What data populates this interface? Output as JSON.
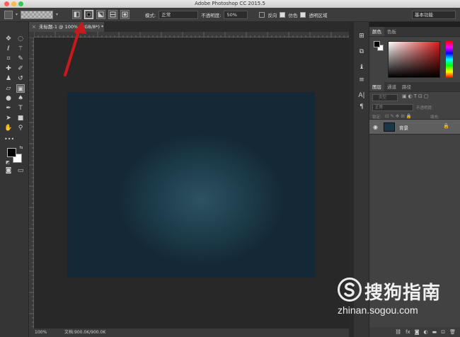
{
  "window": {
    "title": "Adobe Photoshop CC 2015.5"
  },
  "options_bar": {
    "mode_label": "模式:",
    "mode_value": "正常",
    "opacity_label": "不透明度:",
    "opacity_value": "50%",
    "reverse_label": "反向",
    "dither_label": "仿色",
    "transparency_label": "透明区域",
    "workspace": "基本功能",
    "gradient_styles": [
      "linear",
      "radial",
      "angle",
      "reflected",
      "diamond"
    ],
    "active_style": "radial",
    "reverse_checked": false,
    "dither_checked": true,
    "transparency_checked": true
  },
  "document": {
    "tab_label": "未标题-1 @ 100% (RGB/8*) *",
    "close_glyph": "×",
    "canvas_color": "#1d3c4b"
  },
  "status": {
    "zoom": "100%",
    "doc_info": "文档:900.0K/900.0K"
  },
  "panels": {
    "color_tabs": [
      "颜色",
      "色板"
    ],
    "layers_tabs": [
      "图层",
      "通道",
      "路径"
    ],
    "layer_kind_label": "类型",
    "blend_mode": "正常",
    "opacity_label": "不透明度:",
    "lock_label": "锁定:",
    "fill_label": "填充:",
    "layer_name": "背景"
  },
  "watermark": {
    "brand": "搜狗指南",
    "url": "zhinan.sogou.com"
  },
  "colors": {
    "accent_arrow": "#c8191c",
    "foreground": "#000000",
    "background": "#ffffff"
  },
  "icons": [
    "move-icon",
    "marquee-icon",
    "lasso-icon",
    "magic-wand-icon",
    "crop-icon",
    "eyedropper-icon",
    "healing-icon",
    "brush-icon",
    "stamp-icon",
    "history-brush-icon",
    "eraser-icon",
    "gradient-icon",
    "blur-icon",
    "dodge-icon",
    "pen-icon",
    "type-icon",
    "path-select-icon",
    "shape-icon",
    "hand-icon",
    "zoom-icon"
  ]
}
